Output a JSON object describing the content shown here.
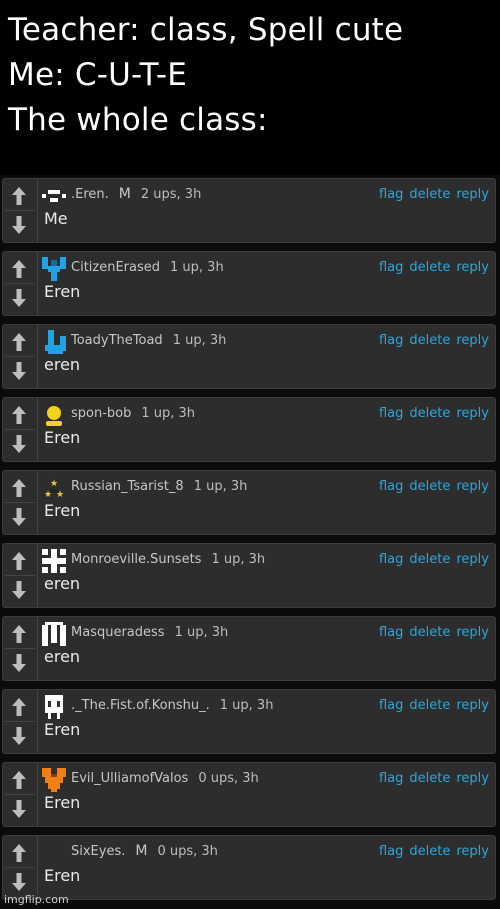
{
  "caption": {
    "line1": "Teacher: class, Spell cute",
    "line2": "Me: C-U-T-E",
    "line3": "The whole class:"
  },
  "actions": {
    "flag": "flag",
    "delete": "delete",
    "reply": "reply"
  },
  "comments": [
    {
      "user": ".Eren.",
      "mod": "M",
      "points": "2 ups, 3h",
      "text": "Me",
      "avatar_icon": "pixel-face-icon"
    },
    {
      "user": "CitizenErased",
      "mod": "",
      "points": "1 up, 3h",
      "text": "Eren",
      "avatar_icon": "blue-pixel-shield-icon"
    },
    {
      "user": "ToadyTheToad",
      "mod": "",
      "points": "1 up, 3h",
      "text": "eren",
      "avatar_icon": "blue-pixel-toad-icon"
    },
    {
      "user": "spon-bob",
      "mod": "",
      "points": "1 up, 3h",
      "text": "Eren",
      "avatar_icon": "yellow-person-icon"
    },
    {
      "user": "Russian_Tsarist_8",
      "mod": "",
      "points": "1 up, 3h",
      "text": "Eren",
      "avatar_icon": "stars-triangle-icon"
    },
    {
      "user": "Monroeville.Sunsets",
      "mod": "",
      "points": "1 up, 3h",
      "text": "eren",
      "avatar_icon": "white-pixel-grid-icon"
    },
    {
      "user": "Masqueradess",
      "mod": "",
      "points": "1 up, 3h",
      "text": "eren",
      "avatar_icon": "white-pixel-mask-icon"
    },
    {
      "user": "._The.Fist.of.Konshu_.",
      "mod": "",
      "points": "1 up, 3h",
      "text": "Eren",
      "avatar_icon": "white-pixel-skull-icon"
    },
    {
      "user": "Evil_UlliamofValos",
      "mod": "",
      "points": "0 ups, 3h",
      "text": "Eren",
      "avatar_icon": "orange-pixel-heart-icon"
    },
    {
      "user": "SixEyes.",
      "mod": "M",
      "points": "0 ups, 3h",
      "text": "Eren",
      "avatar_icon": ""
    }
  ],
  "watermark": "imgflip.com",
  "colors": {
    "link": "#27a8e0",
    "panel": "#2d2d2d",
    "text": "#eaeaea"
  }
}
